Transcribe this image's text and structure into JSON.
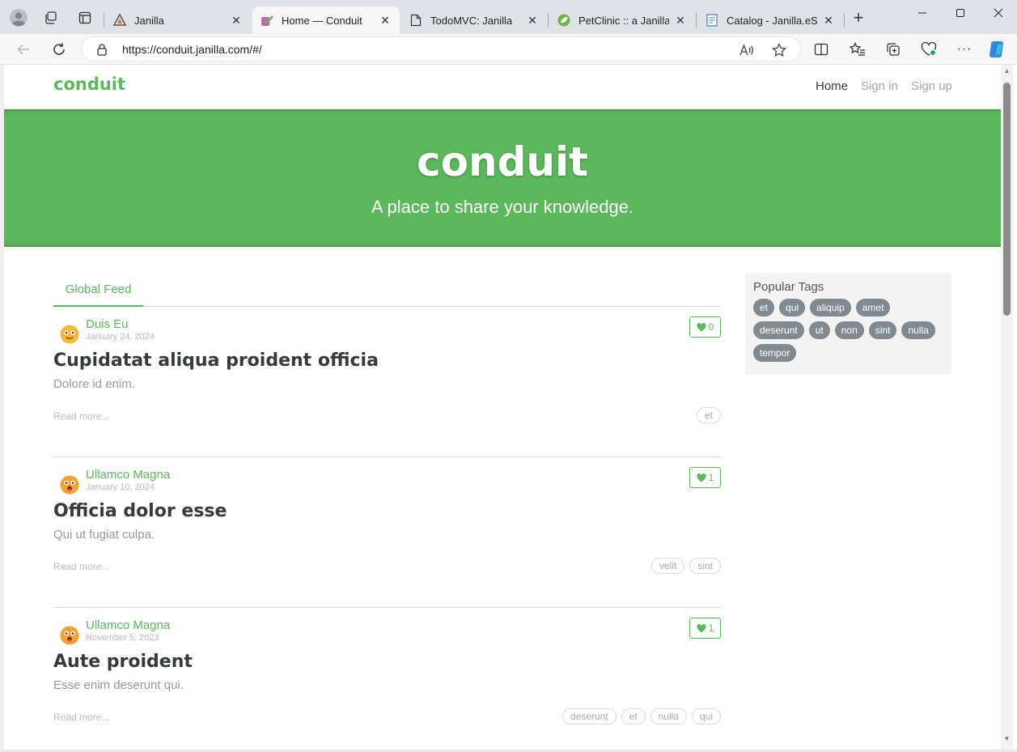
{
  "browser": {
    "tabs": [
      {
        "label": "Janilla",
        "icon": "janilla-favicon-icon"
      },
      {
        "label": "Home — Conduit",
        "icon": "conduit-favicon-icon",
        "active": true
      },
      {
        "label": "TodoMVC: Janilla",
        "icon": "page-favicon-icon"
      },
      {
        "label": "PetClinic :: a Janilla dem",
        "icon": "spring-leaf-favicon-icon"
      },
      {
        "label": "Catalog - Janilla.eShop",
        "icon": "document-favicon-icon"
      }
    ],
    "url": "https://conduit.janilla.com/#/",
    "accent": "#1a73e8"
  },
  "site": {
    "brand": "conduit",
    "nav": {
      "home": "Home",
      "sign_in": "Sign in",
      "sign_up": "Sign up"
    },
    "banner_title": "conduit",
    "banner_subtitle": "A place to share your knowledge.",
    "brand_color": "#5cb85c"
  },
  "feed": {
    "tab": "Global Feed",
    "articles": [
      {
        "author": "Duis Eu",
        "date": "January 24, 2024",
        "favorites": "0",
        "title": "Cupidatat aliqua proident officia",
        "description": "Dolore id enim.",
        "read_more": "Read more...",
        "tags": [
          "et"
        ]
      },
      {
        "author": "Ullamco Magna",
        "date": "January 10, 2024",
        "favorites": "1",
        "title": "Officia dolor esse",
        "description": "Qui ut fugiat culpa.",
        "read_more": "Read more...",
        "tags": [
          "velit",
          "sint"
        ]
      },
      {
        "author": "Ullamco Magna",
        "date": "November 5, 2023",
        "favorites": "1",
        "title": "Aute proident",
        "description": "Esse enim deserunt qui.",
        "read_more": "Read more...",
        "tags": [
          "deserunt",
          "et",
          "nulla",
          "qui"
        ]
      }
    ]
  },
  "sidebar": {
    "title": "Popular Tags",
    "tags": [
      "et",
      "qui",
      "aliquip",
      "amet",
      "deserunt",
      "ut",
      "non",
      "sint",
      "nulla",
      "tempor"
    ]
  }
}
